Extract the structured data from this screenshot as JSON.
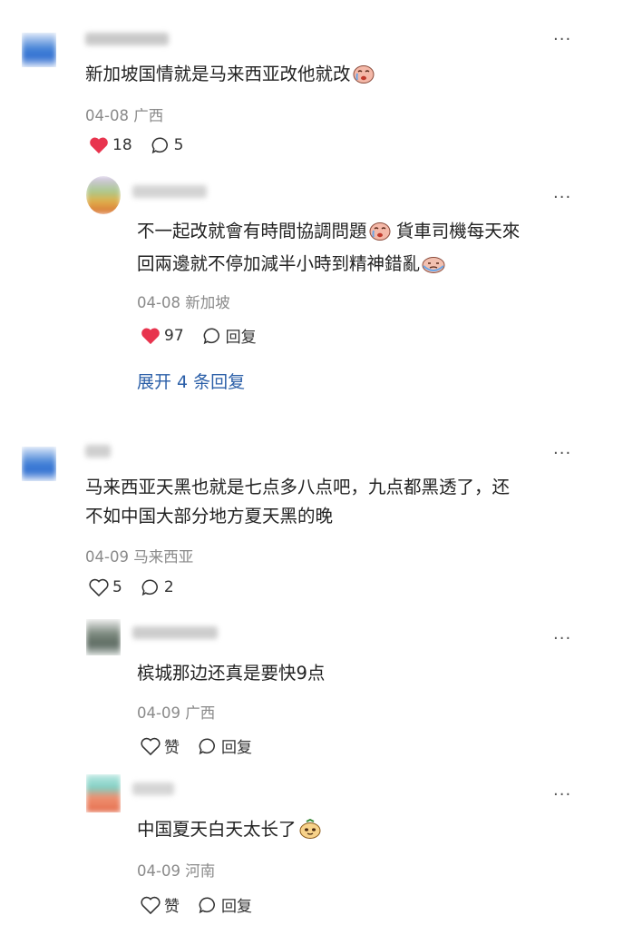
{
  "comments": [
    {
      "text": "新加坡国情就是马来西亚改他就改",
      "date": "04-08",
      "location": "广西",
      "likes": "18",
      "replies": "5",
      "liked": true,
      "sub": {
        "text_line1": "不一起改就會有時間協調問題",
        "text_line2a": "貨車司機每天來",
        "text_line2b": "回兩邊就不停加減半小時到精神錯亂",
        "date": "04-08",
        "location": "新加坡",
        "likes": "97",
        "reply_label": "回复",
        "liked": true
      },
      "expand_label": "展开 4 条回复"
    },
    {
      "text_line1": "马来西亚天黑也就是七点多八点吧，九点都黑透了，还",
      "text_line2": "不如中国大部分地方夏天黑的晚",
      "date": "04-09",
      "location": "马来西亚",
      "likes": "5",
      "replies": "2",
      "subs": [
        {
          "text": "槟城那边还真是要快9点",
          "date": "04-09",
          "location": "广西",
          "like_label": "赞",
          "reply_label": "回复"
        },
        {
          "text": "中国夏天白天太长了",
          "date": "04-09",
          "location": "河南",
          "like_label": "赞",
          "reply_label": "回复"
        }
      ]
    }
  ],
  "colors": {
    "heart": "#e8344e",
    "link": "#2b5fa8",
    "meta": "#8a8a8a"
  },
  "icons": [
    "more-icon",
    "heart-icon",
    "comment-icon",
    "emoji-cry-icon",
    "emoji-sweat-icon",
    "emoji-smirk-icon"
  ]
}
